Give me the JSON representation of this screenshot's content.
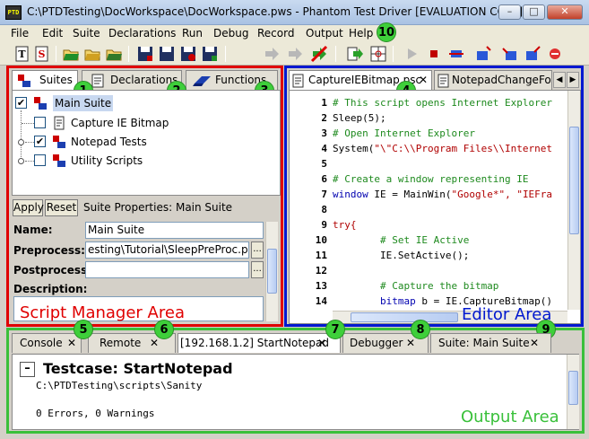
{
  "window": {
    "title": "C:\\PTDTesting\\DocWorkspace\\DocWorkspace.pws - Phantom Test Driver [EVALUATION COPY]",
    "app_icon_text": "PTD",
    "minimize": "–",
    "maximize": "□",
    "close": "✕"
  },
  "menu": [
    "File",
    "Edit",
    "Suite",
    "Declarations",
    "Run",
    "Debug",
    "Record",
    "Output",
    "Help"
  ],
  "badges": [
    "1",
    "2",
    "3",
    "4",
    "5",
    "6",
    "7",
    "8",
    "9",
    "10"
  ],
  "script_manager": {
    "tabs": [
      "Suites",
      "Declarations",
      "Functions"
    ],
    "tree": [
      {
        "label": "Main Suite",
        "checked": true
      },
      {
        "label": "Capture IE Bitmap",
        "checked": false
      },
      {
        "label": "Notepad Tests",
        "checked": true
      },
      {
        "label": "Utility Scripts",
        "checked": false
      }
    ],
    "apply": "Apply",
    "reset": "Reset",
    "properties_title": "Suite Properties: Main Suite",
    "name_label": "Name:",
    "name_value": "Main Suite",
    "preprocess_label": "Preprocess:",
    "preprocess_value": "esting\\Tutorial\\SleepPreProc.psc",
    "postprocess_label": "Postprocess:",
    "postprocess_value": "",
    "description_label": "Description:",
    "dots": "...",
    "area_label": "Script Manager Area",
    "area_color": "#e00000"
  },
  "editor": {
    "tabs": [
      "CaptureIEBitmap.psc",
      "NotepadChangeFor..."
    ],
    "line_numbers": [
      "1",
      "2",
      "3",
      "4",
      "5",
      "6",
      "7",
      "8",
      "9",
      "10",
      "11",
      "12",
      "13",
      "14"
    ],
    "lines": {
      "l1": "# This script opens Internet Explorer",
      "l2": "Sleep(5);",
      "l3": "# Open Internet Explorer",
      "l4a": "System(",
      "l4b": "\"\\\"C:\\\\Program Files\\\\Internet",
      "l6": "# Create a window representing IE",
      "l7a": "window",
      "l7b": " IE = MainWin(",
      "l7c": "\"Google*\", \"IEFra",
      "l9": "try{",
      "l10": "        # Set IE Active",
      "l11": "        IE.SetActive();",
      "l13": "        # Capture the bitmap",
      "l14a": "        bitmap",
      "l14b": " b = IE.CaptureBitmap()"
    },
    "area_label": "Editor Area",
    "area_color": "#0018d0"
  },
  "output": {
    "tabs": [
      "Console",
      "Remote",
      "[192.168.1.2] StartNotepad",
      "Debugger",
      "Suite: Main Suite"
    ],
    "collapse": "–",
    "testcase": "Testcase: StartNotepad",
    "path": "C:\\PTDTesting\\scripts\\Sanity",
    "summary": "0 Errors, 0 Warnings",
    "area_label": "Output Area",
    "area_color": "#39c03a"
  }
}
